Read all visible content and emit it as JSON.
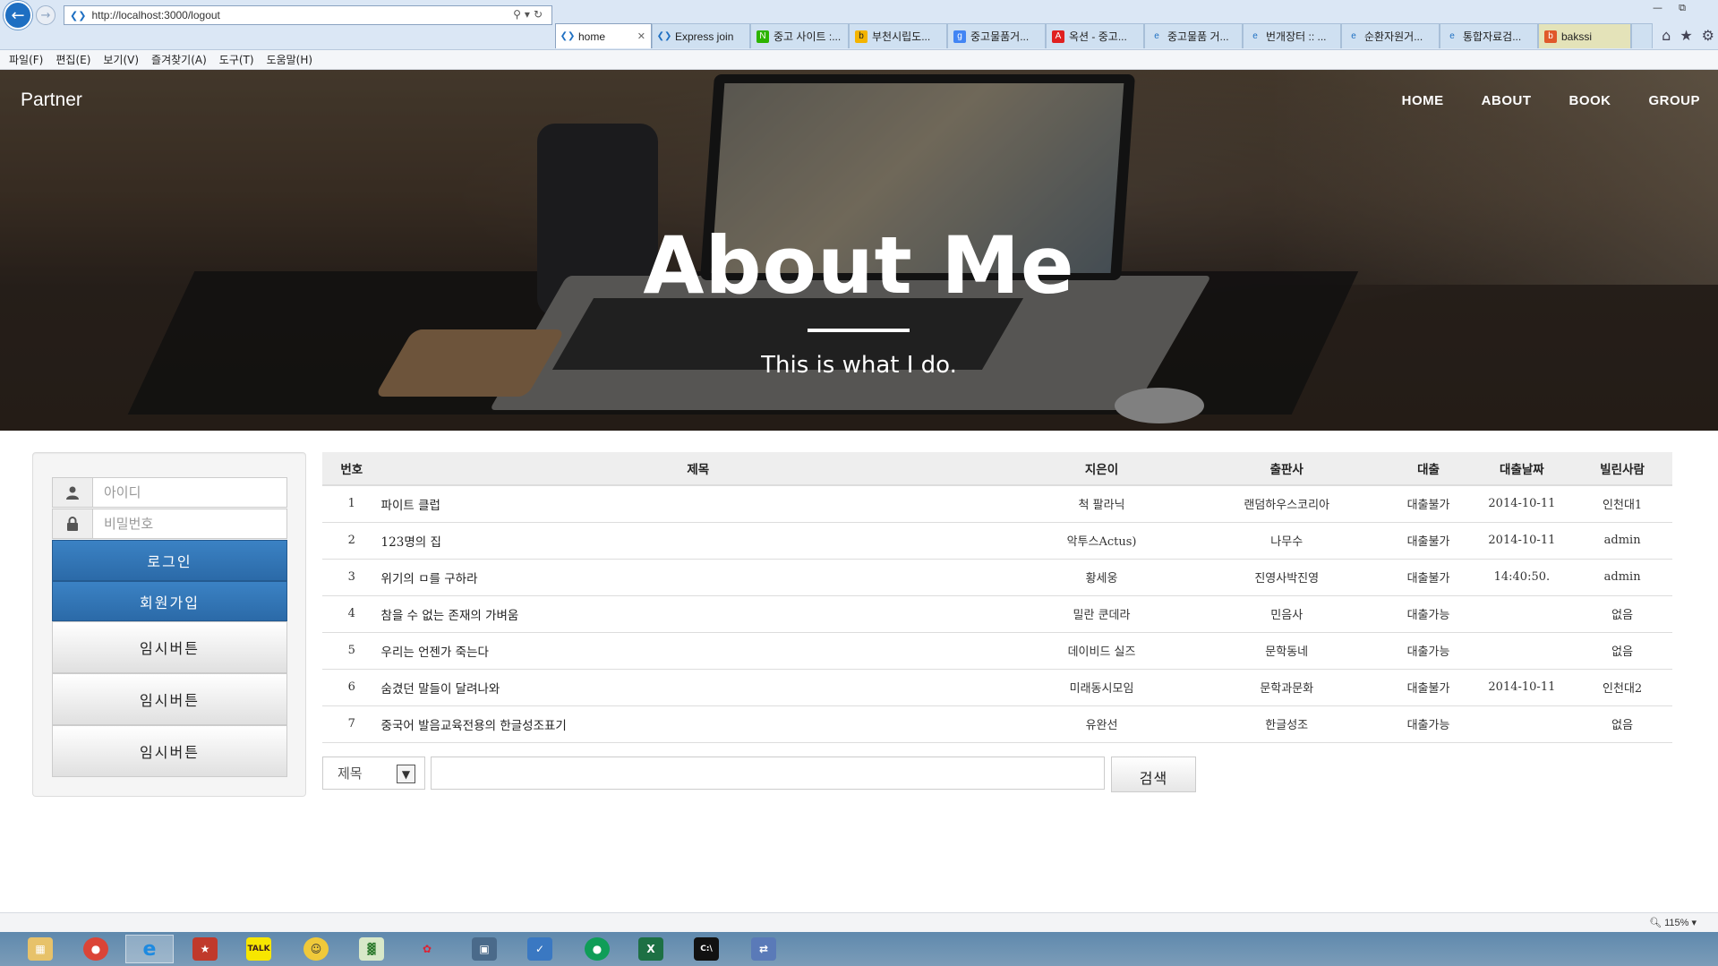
{
  "browser": {
    "url": "http://localhost:3000/logout",
    "tabs": [
      {
        "label": "home",
        "active": true,
        "icon": "ie-page-icon"
      },
      {
        "label": "Express join",
        "active": false,
        "icon": "ie-page-icon"
      },
      {
        "label": "중고 사이트 :...",
        "active": false,
        "icon": "naver-icon"
      },
      {
        "label": "부천시립도...",
        "active": false,
        "icon": "bing-icon"
      },
      {
        "label": "중고물품거...",
        "active": false,
        "icon": "google-icon"
      },
      {
        "label": "옥션 - 중고...",
        "active": false,
        "icon": "auction-icon"
      },
      {
        "label": "중고물품 거...",
        "active": false,
        "icon": "ie-icon"
      },
      {
        "label": "번개장터 :: ...",
        "active": false,
        "icon": "ie-icon"
      },
      {
        "label": "순환자원거...",
        "active": false,
        "icon": "ie-icon"
      },
      {
        "label": "통합자료검...",
        "active": false,
        "icon": "ie-icon"
      },
      {
        "label": "bakssi",
        "active": false,
        "icon": "bakssi-icon"
      }
    ],
    "menu": [
      "파일(F)",
      "편집(E)",
      "보기(V)",
      "즐겨찾기(A)",
      "도구(T)",
      "도움말(H)"
    ],
    "zoom": "115%"
  },
  "site": {
    "brand": "Partner",
    "nav": [
      "HOME",
      "ABOUT",
      "BOOK",
      "GROUP"
    ],
    "hero_title": "About Me",
    "hero_subtitle": "This is what I do."
  },
  "login": {
    "id_placeholder": "아이디",
    "pw_placeholder": "비밀번호",
    "login_label": "로그인",
    "join_label": "회원가입",
    "temp_buttons": [
      "임시버튼",
      "임시버튼",
      "임시버튼"
    ]
  },
  "books": {
    "headers": [
      "번호",
      "제목",
      "지은이",
      "출판사",
      "대출",
      "대출날짜",
      "빌린사람"
    ],
    "rows": [
      [
        "1",
        "파이트 클럽",
        "척 팔라닉",
        "랜덤하우스코리아",
        "대출불가",
        "2014-10-11",
        "인천대1"
      ],
      [
        "2",
        "123명의 집",
        "악투스Actus)",
        "나무수",
        "대출불가",
        "2014-10-11",
        "admin"
      ],
      [
        "3",
        "위기의 ㅁ를 구하라",
        "황세웅",
        "진영사박진영",
        "대출불가",
        "14:40:50.",
        "admin"
      ],
      [
        "4",
        "참을 수 없는 존재의 가벼움",
        "밀란 쿤데라",
        "민음사",
        "대출가능",
        "",
        "없음"
      ],
      [
        "5",
        "우리는 언젠가 죽는다",
        "데이비드 실즈",
        "문학동네",
        "대출가능",
        "",
        "없음"
      ],
      [
        "6",
        "숨겼던 말들이 달려나와",
        "미래동시모임",
        "문학과문화",
        "대출불가",
        "2014-10-11",
        "인천대2"
      ],
      [
        "7",
        "중국어 발음교육전용의 한글성조표기",
        "유완선",
        "한글성조",
        "대출가능",
        "",
        "없음"
      ]
    ]
  },
  "search": {
    "field_selected": "제목",
    "button_label": "검색"
  },
  "colors": {
    "primary_button": "#3177b8",
    "chrome_bg": "#dbe7f5",
    "taskbar": "#6c8fae"
  }
}
